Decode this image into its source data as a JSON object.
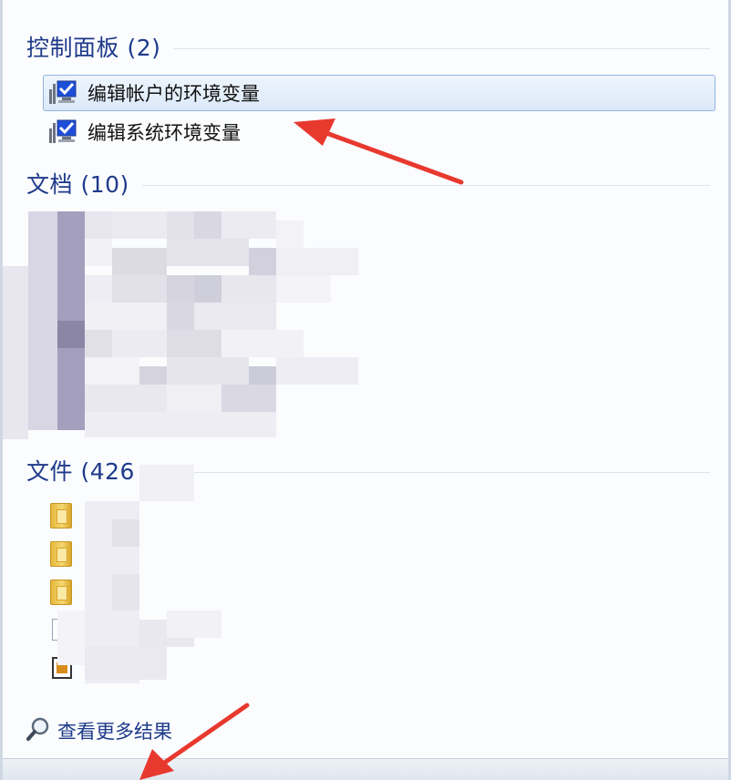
{
  "sections": {
    "control_panel": {
      "title": "控制面板 (2)",
      "items": [
        {
          "label": "编辑帐户的环境变量",
          "selected": true
        },
        {
          "label": "编辑系统环境变量",
          "selected": false
        }
      ]
    },
    "documents": {
      "title": "文档 (10)"
    },
    "files": {
      "title": "文件 (426"
    }
  },
  "more_results": {
    "label": "查看更多结果"
  },
  "colors": {
    "header_text": "#1e3a8a",
    "selection": "#dbe9f9",
    "annotation_arrow": "#e8392f"
  },
  "icons": {
    "control_panel_item": "monitor-checkmark-icon",
    "file_folder": "folder-icon",
    "more_results": "search-icon"
  }
}
